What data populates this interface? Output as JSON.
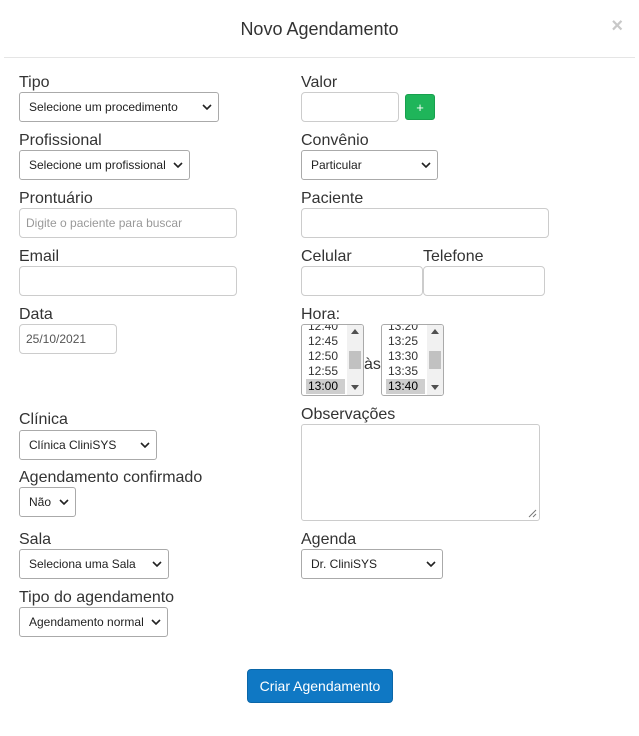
{
  "modal": {
    "title": "Novo Agendamento",
    "close_glyph": "×"
  },
  "form": {
    "tipo": {
      "label": "Tipo",
      "value": "Selecione um procedimento"
    },
    "valor": {
      "label": "Valor",
      "value": "",
      "add_label": "+"
    },
    "profissional": {
      "label": "Profissional",
      "value": "Selecione um profissional"
    },
    "convenio": {
      "label": "Convênio",
      "value": "Particular"
    },
    "prontuario": {
      "label": "Prontuário",
      "placeholder": "Digite o paciente para buscar",
      "value": ""
    },
    "paciente": {
      "label": "Paciente",
      "value": ""
    },
    "email": {
      "label": "Email",
      "value": ""
    },
    "celular": {
      "label": "Celular",
      "value": ""
    },
    "telefone": {
      "label": "Telefone",
      "value": ""
    },
    "data": {
      "label": "Data",
      "value": "25/10/2021"
    },
    "hora": {
      "label": "Hora:",
      "separator": "às",
      "start_options": [
        "12:40",
        "12:45",
        "12:50",
        "12:55",
        "13:00"
      ],
      "start_selected": "13:00",
      "end_options": [
        "13:20",
        "13:25",
        "13:30",
        "13:35",
        "13:40"
      ],
      "end_selected": "13:40"
    },
    "clinica": {
      "label": "Clínica",
      "value": "Clínica CliniSYS"
    },
    "observacoes": {
      "label": "Observações",
      "value": ""
    },
    "agendamento_confirmado": {
      "label": "Agendamento confirmado",
      "value": "Não"
    },
    "sala": {
      "label": "Sala",
      "value": "Seleciona uma Sala"
    },
    "agenda": {
      "label": "Agenda",
      "value": "Dr. CliniSYS"
    },
    "tipo_agendamento": {
      "label": "Tipo do agendamento",
      "value": "Agendamento normal"
    }
  },
  "actions": {
    "create_label": "Criar Agendamento"
  },
  "colors": {
    "primary": "#0f78c4",
    "success": "#1fb55a",
    "text": "#333333",
    "border": "#cccccc"
  }
}
